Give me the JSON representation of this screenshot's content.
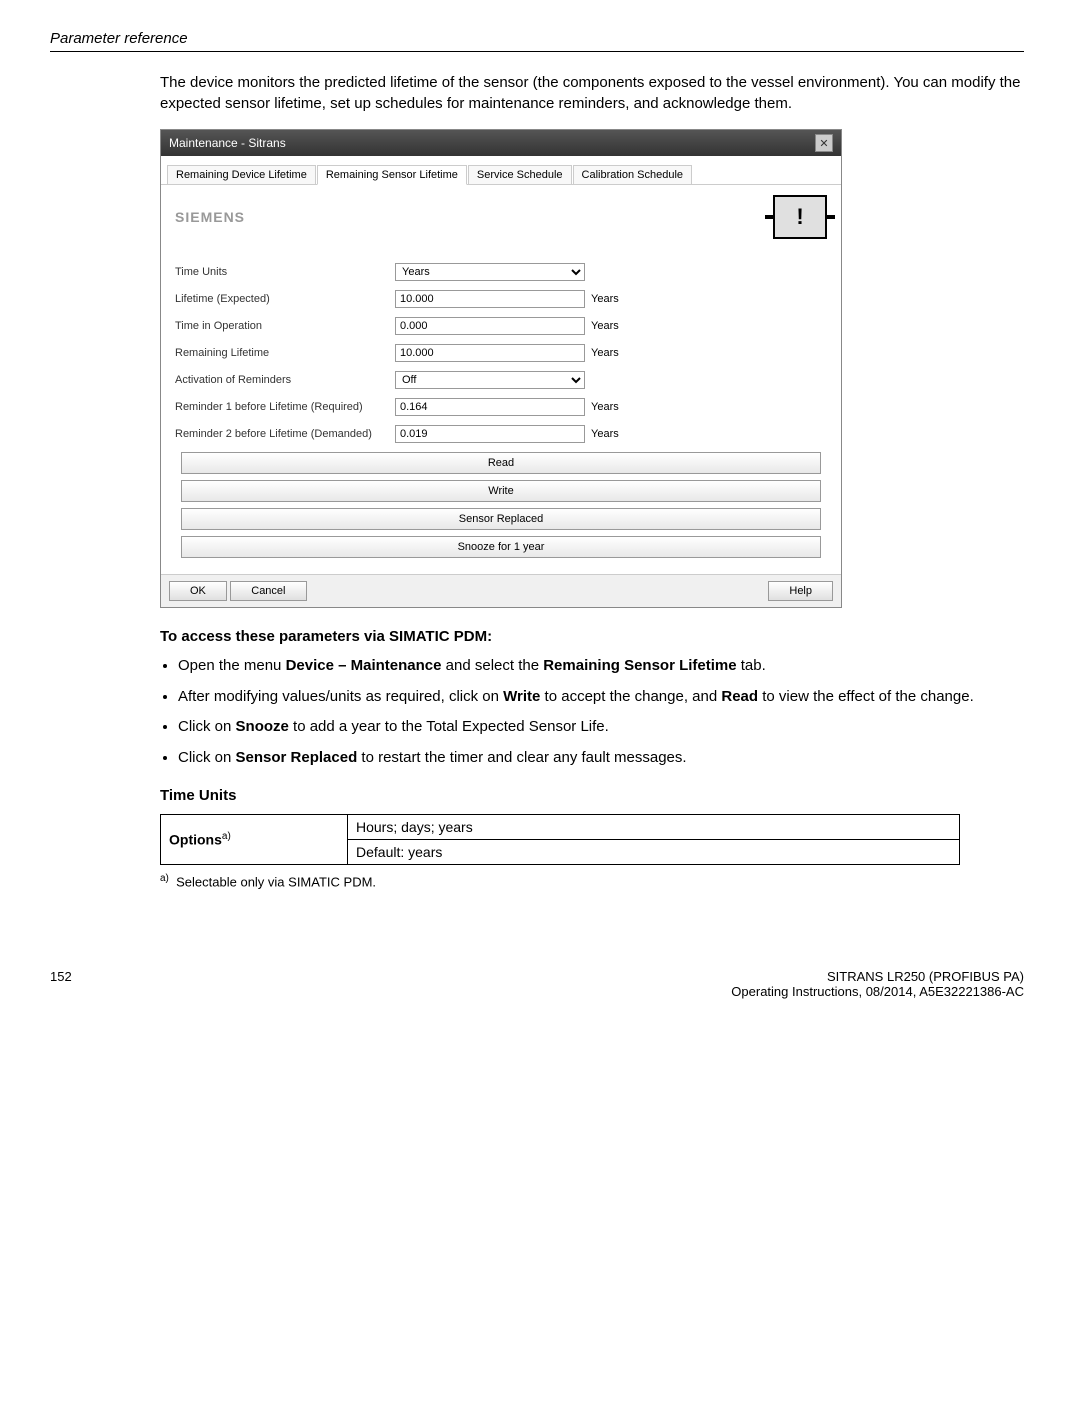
{
  "header": {
    "title": "Parameter reference"
  },
  "intro": "The device monitors the predicted lifetime of the sensor (the components exposed to the vessel environment). You can modify the expected sensor lifetime, set up schedules for maintenance reminders, and acknowledge them.",
  "dialog": {
    "title": "Maintenance - Sitrans",
    "tabs": [
      "Remaining Device Lifetime",
      "Remaining Sensor Lifetime",
      "Service Schedule",
      "Calibration Schedule"
    ],
    "active_tab_index": 1,
    "logo": "SIEMENS",
    "rows": [
      {
        "label": "Time Units",
        "type": "select",
        "value": "Years",
        "unit": ""
      },
      {
        "label": "Lifetime (Expected)",
        "type": "input",
        "value": "10.000",
        "unit": "Years"
      },
      {
        "label": "Time in Operation",
        "type": "input",
        "value": "0.000",
        "unit": "Years"
      },
      {
        "label": "Remaining Lifetime",
        "type": "input",
        "value": "10.000",
        "unit": "Years"
      },
      {
        "label": "Activation of Reminders",
        "type": "select",
        "value": "Off",
        "unit": ""
      },
      {
        "label": "Reminder 1 before Lifetime (Required)",
        "type": "input",
        "value": "0.164",
        "unit": "Years"
      },
      {
        "label": "Reminder 2 before Lifetime (Demanded)",
        "type": "input",
        "value": "0.019",
        "unit": "Years"
      }
    ],
    "buttons": [
      "Read",
      "Write",
      "Sensor Replaced",
      "Snooze for 1 year"
    ],
    "footer": {
      "ok": "OK",
      "cancel": "Cancel",
      "help": "Help"
    }
  },
  "access_heading": "To access these parameters via SIMATIC PDM:",
  "instructions": [
    {
      "pre": "Open the menu ",
      "b1": "Device – Maintenance",
      "mid": " and select the ",
      "b2": "Remaining Sensor Lifetime",
      "post": " tab."
    },
    {
      "pre": "After modifying values/units as required, click on ",
      "b1": "Write",
      "mid": " to accept the change, and ",
      "b2": "Read",
      "post": " to view the effect of the change."
    },
    {
      "pre": "Click on ",
      "b1": "Snooze",
      "mid": " to add a year to the Total Expected Sensor Life.",
      "b2": "",
      "post": ""
    },
    {
      "pre": "Click on ",
      "b1": "Sensor Replaced",
      "mid": " to restart the timer and clear any fault messages.",
      "b2": "",
      "post": ""
    }
  ],
  "time_units_heading": "Time Units",
  "options_table": {
    "label": "Options",
    "sup": "a)",
    "row1": "Hours; days; years",
    "row2": "Default: years"
  },
  "footnote": {
    "sup": "a)",
    "text": "Selectable only via SIMATIC PDM."
  },
  "footer": {
    "page": "152",
    "product": "SITRANS LR250 (PROFIBUS PA)",
    "docinfo": "Operating Instructions, 08/2014, A5E32221386-AC"
  }
}
